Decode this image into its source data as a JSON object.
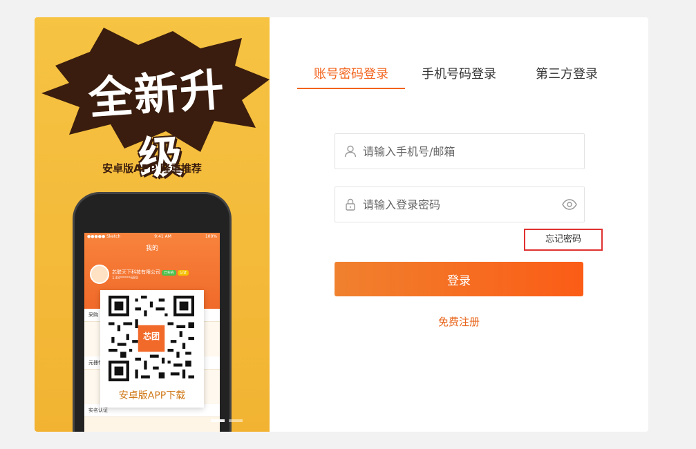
{
  "promo": {
    "headline": "全新升级",
    "subtitle": "安卓版APP  隆重推荐",
    "phone": {
      "status_left": "●●●●● Sketch",
      "status_time": "9:41 AM",
      "status_battery": "100%",
      "screen_title": "我的",
      "company": "芯联天下科技有限公司",
      "tag_verified": "已实名",
      "tag_level": "认证",
      "phone_masked": "138*****689",
      "row1": "采购",
      "row2": "元器件",
      "row3": "实名认证"
    },
    "qr_caption": "安卓版APP下载",
    "qr_logo": "芯团"
  },
  "tabs": [
    {
      "label": "账号密码登录",
      "active": true
    },
    {
      "label": "手机号码登录",
      "active": false
    },
    {
      "label": "第三方登录",
      "active": false
    }
  ],
  "form": {
    "account_placeholder": "请输入手机号/邮箱",
    "password_placeholder": "请输入登录密码",
    "forgot": "忘记密码",
    "login": "登录",
    "register": "免费注册"
  },
  "colors": {
    "accent": "#f2631c",
    "promo_bg": "#f4bb3a"
  }
}
